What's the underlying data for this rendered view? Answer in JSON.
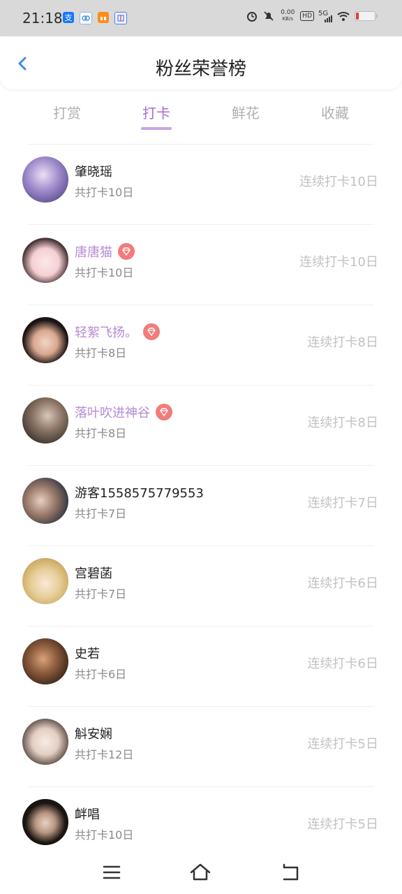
{
  "status_bar": {
    "time": "21:18",
    "net_speed_value": "0.00",
    "net_speed_unit": "KB/s",
    "hd": "HD",
    "network": "5G",
    "icons": [
      "alipay-icon",
      "app-icon",
      "gift-icon",
      "pin-icon",
      "alarm-icon",
      "mute-icon",
      "wifi-icon",
      "battery-icon"
    ]
  },
  "header": {
    "title": "粉丝荣誉榜",
    "back_icon": "chevron-left-icon"
  },
  "tabs": [
    "打赏",
    "打卡",
    "鲜花",
    "收藏"
  ],
  "active_tab": "打卡",
  "colors": {
    "accent": "#a96cd4",
    "vip_name": "#b58ad6",
    "badge": "#f27b7b",
    "muted_text": "#8a8a8a",
    "streak_text": "#c2c2c2",
    "back_arrow": "#3a8ee6"
  },
  "fans": [
    {
      "name": "肇晓瑶",
      "total": "共打卡10日",
      "streak": "连续打卡10日",
      "vip": false
    },
    {
      "name": "唐唐猫",
      "total": "共打卡10日",
      "streak": "连续打卡10日",
      "vip": true
    },
    {
      "name": "轻絮飞扬。",
      "total": "共打卡8日",
      "streak": "连续打卡8日",
      "vip": true
    },
    {
      "name": "落叶吹进神谷",
      "total": "共打卡8日",
      "streak": "连续打卡8日",
      "vip": true
    },
    {
      "name": "游客1558575779553",
      "total": "共打卡7日",
      "streak": "连续打卡7日",
      "vip": false
    },
    {
      "name": "宫碧菡",
      "total": "共打卡7日",
      "streak": "连续打卡6日",
      "vip": false
    },
    {
      "name": "史若",
      "total": "共打卡6日",
      "streak": "连续打卡6日",
      "vip": false
    },
    {
      "name": "斛安娴",
      "total": "共打卡12日",
      "streak": "连续打卡5日",
      "vip": false
    },
    {
      "name": "衅唱",
      "total": "共打卡10日",
      "streak": "连续打卡5日",
      "vip": false
    }
  ],
  "nav": {
    "icons": [
      "menu-icon",
      "home-icon",
      "back-icon"
    ]
  }
}
